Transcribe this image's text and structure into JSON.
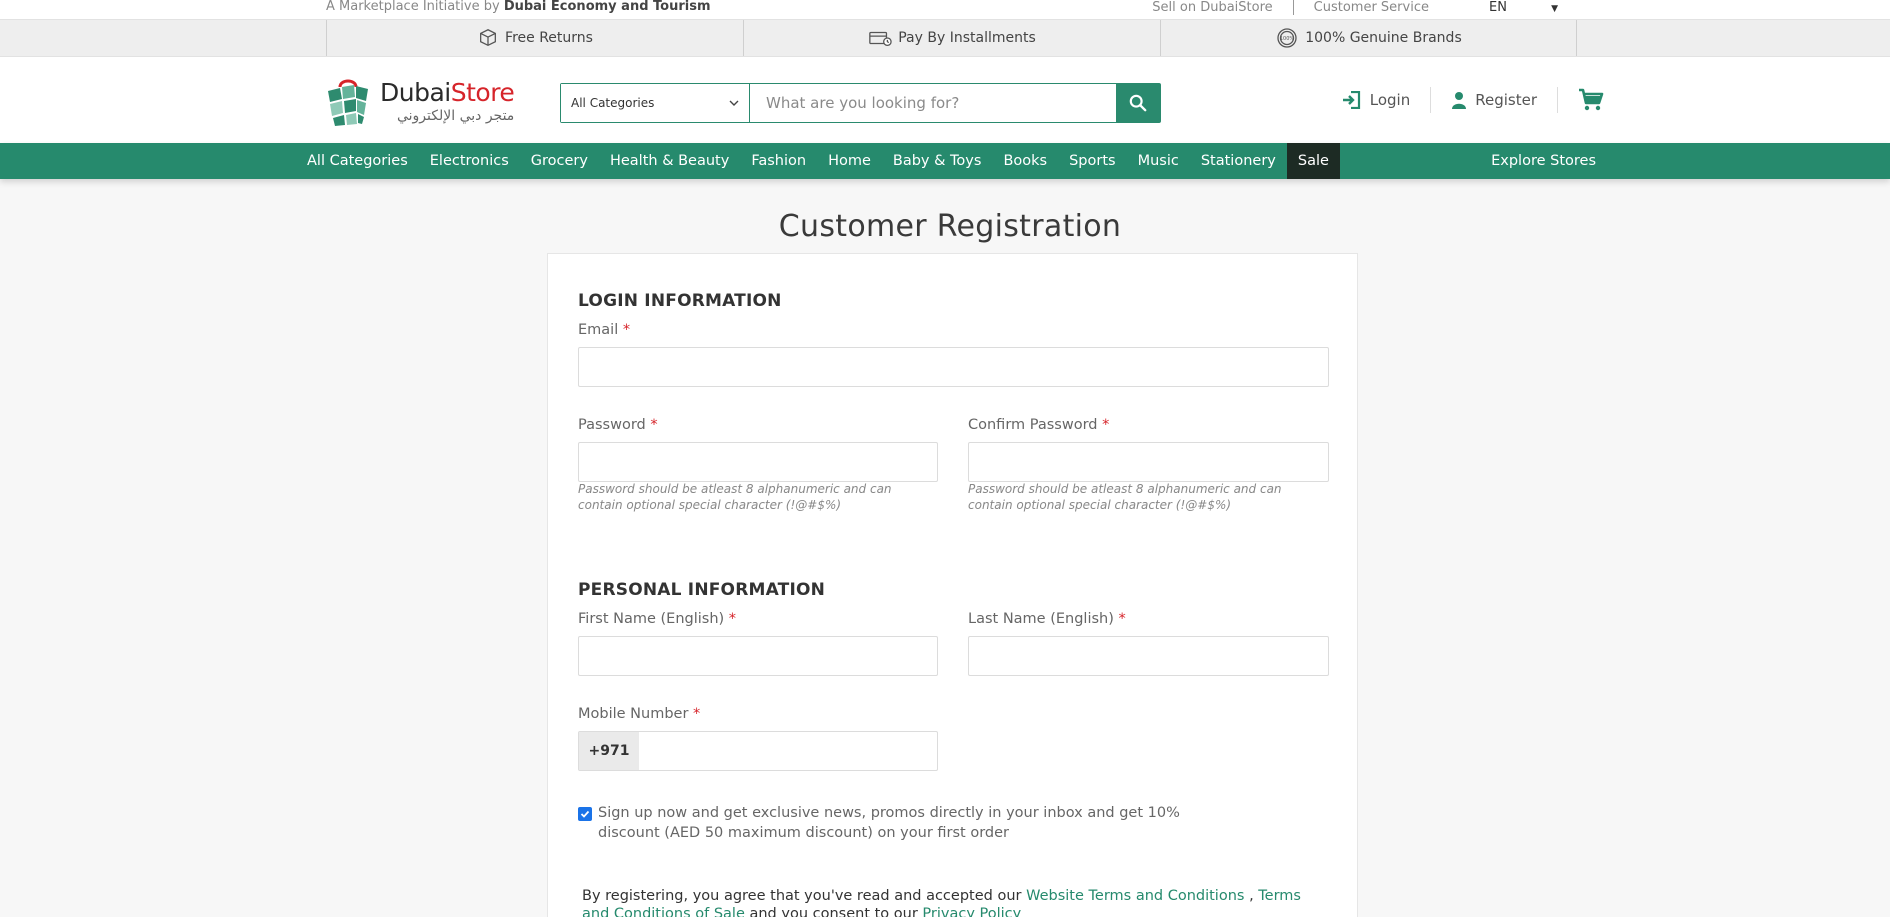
{
  "topbar": {
    "initiative_prefix": "A Marketplace Initiative by",
    "initiative_org": "Dubai Economy and Tourism",
    "sell_link": "Sell on DubaiStore",
    "service_link": "Customer Service",
    "language": "EN"
  },
  "benefits": [
    {
      "label": "Free Returns",
      "icon": "return-box-icon"
    },
    {
      "label": "Pay By Installments",
      "icon": "installments-icon"
    },
    {
      "label": "100% Genuine Brands",
      "icon": "genuine-badge-icon"
    }
  ],
  "logo": {
    "name_part1": "Dubai",
    "name_part2": "Store",
    "arabic": "متجر دبي الإلكتروني"
  },
  "search": {
    "category": "All Categories",
    "placeholder": "What are you looking for?"
  },
  "account": {
    "login": "Login",
    "register": "Register"
  },
  "nav": {
    "items": [
      "All Categories",
      "Electronics",
      "Grocery",
      "Health & Beauty",
      "Fashion",
      "Home",
      "Baby & Toys",
      "Books",
      "Sports",
      "Music",
      "Stationery",
      "Sale"
    ],
    "explore": "Explore Stores"
  },
  "page": {
    "title": "Customer Registration"
  },
  "form": {
    "login_section": "LOGIN INFORMATION",
    "email_label": "Email",
    "password_label": "Password",
    "confirm_password_label": "Confirm Password",
    "password_hint": "Password should be atleast 8 alphanumeric and can contain optional special character (!@#$%)",
    "personal_section": "PERSONAL INFORMATION",
    "first_name_label": "First Name (English)",
    "last_name_label": "Last Name (English)",
    "mobile_label": "Mobile Number",
    "mobile_prefix": "+971",
    "required_mark": "*",
    "newsletter_text": "Sign up now and get exclusive news, promos directly in your inbox and get 10% discount (AED 50 maximum discount) on your first order",
    "newsletter_checked": true,
    "terms_prefix": "By registering, you agree that you've read and accepted our",
    "terms_link1": "Website Terms and Conditions",
    "terms_comma": ",",
    "terms_link2": "Terms and Conditions of Sale",
    "terms_middle": "and you consent to our",
    "terms_link3": "Privacy Policy"
  },
  "colors": {
    "brand_green": "#268a6d",
    "brand_red": "#d6242a",
    "sale_bg": "#1d2b24",
    "checkbox_blue": "#1a73e8"
  }
}
